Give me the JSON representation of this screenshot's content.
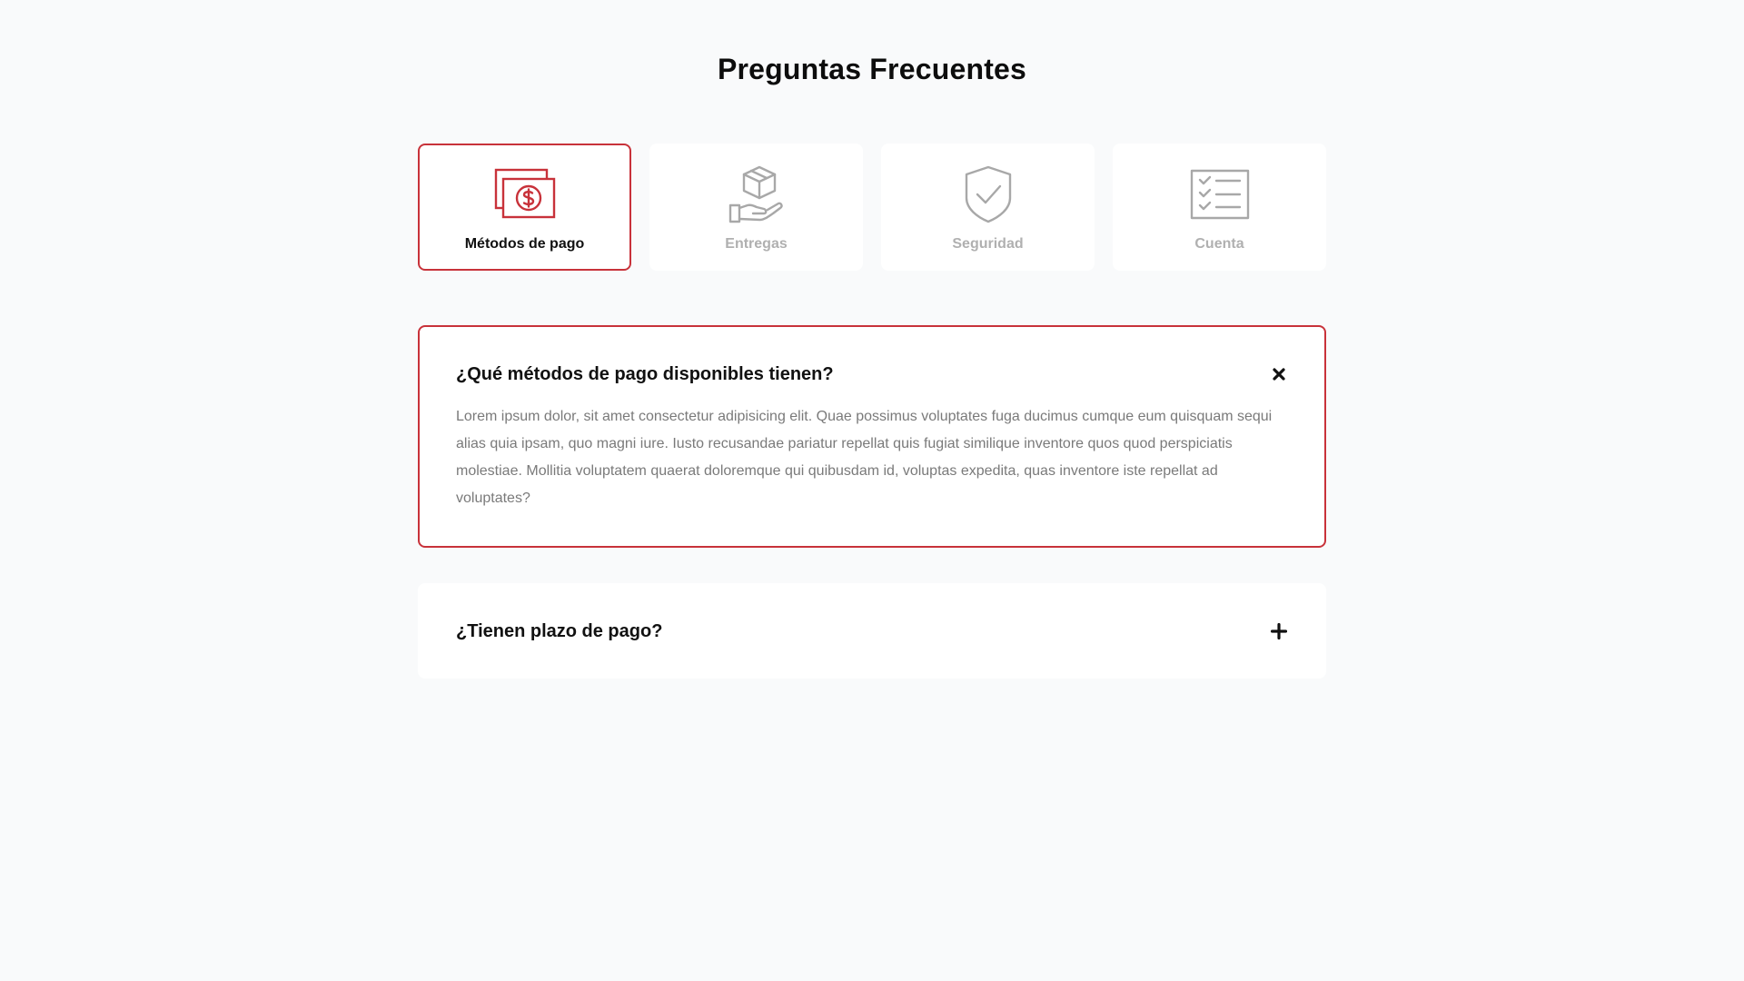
{
  "page": {
    "title": "Preguntas Frecuentes"
  },
  "colors": {
    "accent": "#c8323a",
    "inactive_icon": "#a8a8a8",
    "inactive_text": "#b0b0b0",
    "background": "#f9fafb",
    "card": "#ffffff"
  },
  "categories": [
    {
      "label": "Métodos de pago",
      "icon": "money-icon",
      "active": true
    },
    {
      "label": "Entregas",
      "icon": "package-hand-icon",
      "active": false
    },
    {
      "label": "Seguridad",
      "icon": "shield-check-icon",
      "active": false
    },
    {
      "label": "Cuenta",
      "icon": "checklist-icon",
      "active": false
    }
  ],
  "faqs": [
    {
      "question": "¿Qué métodos de pago disponibles tienen?",
      "answer": "Lorem ipsum dolor, sit amet consectetur adipisicing elit. Quae possimus voluptates fuga ducimus cumque eum quisquam sequi alias quia ipsam, quo magni iure. Iusto recusandae pariatur repellat quis fugiat similique inventore quos quod perspiciatis molestiae. Mollitia voluptatem quaerat doloremque qui quibusdam id, voluptas expedita, quas inventore iste repellat ad voluptates?",
      "open": true,
      "toggle_icon": "close-icon"
    },
    {
      "question": "¿Tienen plazo de pago?",
      "open": false,
      "toggle_icon": "plus-icon"
    }
  ]
}
